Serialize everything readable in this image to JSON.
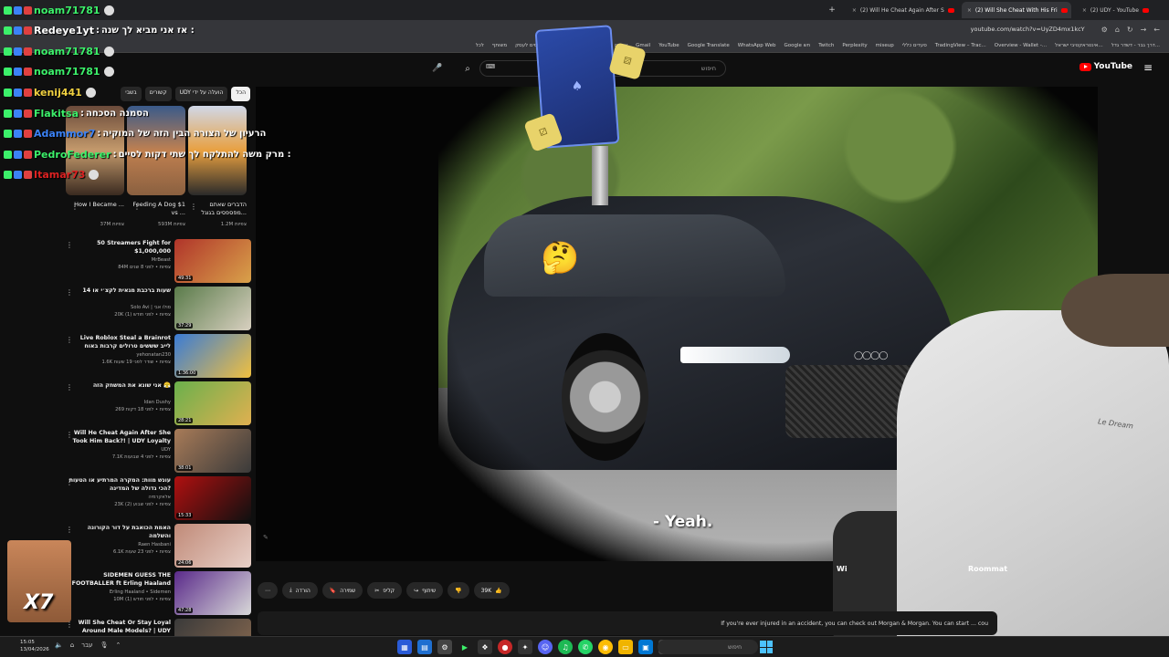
{
  "browser": {
    "tabs": [
      {
        "title": "(2) Will He Cheat Again After S",
        "active": false
      },
      {
        "title": "(2) Will She Cheat With His Fri",
        "active": true
      },
      {
        "title": "(2) UDY - YouTube",
        "active": false
      }
    ],
    "url": "youtube.com/watch?v=UyZD4mx1kcY",
    "bookmarks": [
      "לכל",
      "משותף",
      "מדריך מיסים לעסק",
      "פורטל האב",
      "IG2",
      "עבודה",
      "Gmail",
      "YouTube",
      "Google Translate",
      "WhatsApp Web",
      "Google חש",
      "Twitch",
      "Perplexity",
      "miseup",
      "סעדים כללי",
      "TradingView – Trac...",
      "Overview - Wallet -...",
      "אינטראקטיבי ישראל...",
      "דרך גבר - דשדר גדל..."
    ]
  },
  "youtube": {
    "logo_text": "YouTube",
    "search_placeholder": "חיפוש",
    "chips": [
      "הכל",
      "UDY הועלה על ידי",
      "קשורים",
      "בשבי"
    ],
    "shorts": [
      {
        "title": "הדברים שאתם מפספסים בגוגל...",
        "views": "1.2M צפיות"
      },
      {
        "title": "Feeding A Dog $1 vs ...",
        "views": "593M צפיות"
      },
      {
        "title": "How I Became ...",
        "views": "37M צפיות"
      }
    ],
    "videos": [
      {
        "title": "50 Streamers Fight for $1,000,000",
        "channel": "MrBeast",
        "meta": "84M צפיות • לפני 8 שנים",
        "duration": "49:31",
        "colors": [
          "#b0342a",
          "#d9a24a"
        ]
      },
      {
        "title": "14 שעות ברכבת מגאית לקצ׳י או",
        "channel": "Solo Avi | סולו אבי",
        "meta": "20K צפיות • לפני חודש (1)",
        "duration": "37:29",
        "colors": [
          "#5a7b4a",
          "#d8d0c0"
        ]
      },
      {
        "title": "Live Roblox Steal a Brainrot לייב שששים טרולים קרבות באוח",
        "channel": "yehonatan230",
        "meta": "1.6K צפיות • שודר לפני 19 שעות",
        "duration": "1:36:00",
        "colors": [
          "#3a7bd5",
          "#f0c040"
        ]
      },
      {
        "title": "אני שונא את המשחק הזה 😤",
        "channel": "Idan Dushy",
        "meta": "269 צפיות • לפני 18 דקות",
        "duration": "28:21",
        "colors": [
          "#6ab04c",
          "#e0b050"
        ]
      },
      {
        "title": "Will He Cheat Again After She Took Him Back?! | UDY Loyalty",
        "channel": "UDY",
        "meta": "7.1K צפיות • לפני 4 שבועות",
        "duration": "38:01",
        "colors": [
          "#a87b58",
          "#3a3a3a"
        ]
      },
      {
        "title": "עונש מוות: המקרה המרתיע או הטעות הכי גדולה של המדינה?",
        "channel": "אלאקרמיה",
        "meta": "23K צפיות • לפני שבוע (2)",
        "duration": "15:33",
        "colors": [
          "#b01010",
          "#101010"
        ]
      },
      {
        "title": "האמת הכואבת על דור הקורונה והשלמה",
        "channel": "Raen Hasbani",
        "meta": "6.1K צפיות • לפני 23 שעות",
        "duration": "24:06",
        "colors": [
          "#c08a78",
          "#e8d0c8"
        ]
      },
      {
        "title": "SIDEMEN GUESS THE FOOTBALLER ft Erling Haaland",
        "channel": "Erling Haaland • Sidemen",
        "meta": "10M צפיות • לפני חודש (1)",
        "duration": "47:28",
        "colors": [
          "#5a2a8a",
          "#d8d8d8"
        ]
      },
      {
        "title": "Will She Cheat Or Stay Loyal Around Male Models? | UDY",
        "channel": "UDY",
        "meta": "",
        "duration": "",
        "colors": [
          "#3a3a3a",
          "#8a6a50"
        ]
      }
    ],
    "actions": {
      "likes": "39K",
      "share": "שיתוף",
      "clip": "קליפ",
      "save": "שמירה",
      "download": "הורדה"
    },
    "description": "If you're ever injured in an accident, you can check out Morgan & Morgan. You can start ... cou",
    "video_subtitle": "- Yeah.",
    "channel_overlay_label": "Roommat",
    "w_label": "Wi"
  },
  "chat": [
    {
      "user": "noam71781",
      "text": "",
      "color": "#3cf06a"
    },
    {
      "user": "Redeye1yt",
      "text": "אז אני מביא לך שנה :",
      "color": "#ffffff"
    },
    {
      "user": "noam71781",
      "text": "",
      "color": "#3cf06a"
    },
    {
      "user": "noam71781",
      "text": "",
      "color": "#3cf06a"
    },
    {
      "user": "kenij441",
      "text": "",
      "color": "#f0d040"
    },
    {
      "user": "Flakitsa",
      "text": "הסמנה הסכחה",
      "color": "#3cf06a"
    },
    {
      "user": "Adammor7",
      "text": "הרעיון של הצורה הבין הזה של המוקיה",
      "color": "#3b82f6"
    },
    {
      "user": "PedroFederer",
      "text": "מרק משה להתלקח לך שתי דקות לסיים :",
      "color": "#3cf06a"
    },
    {
      "user": "Itamar73",
      "text": "",
      "color": "#d22"
    }
  ],
  "emote_text": "X7",
  "taskbar": {
    "time": "15:05",
    "date": "13/04/2026",
    "lang": "עבר",
    "search_placeholder": "חיפוש"
  },
  "colors": {
    "bg": "#0f0f0f",
    "accent": "#ff0000"
  }
}
